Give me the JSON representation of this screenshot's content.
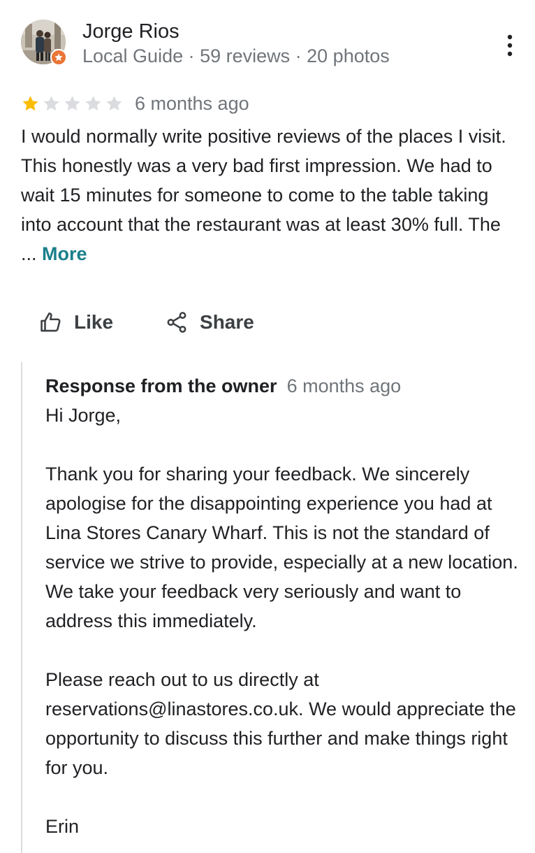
{
  "reviewer": {
    "name": "Jorge Rios",
    "meta": "Local Guide · 59 reviews · 20 photos"
  },
  "review": {
    "rating": 1,
    "max_rating": 5,
    "date": "6 months ago",
    "text": "I would normally write positive reviews of the places I visit. This honestly was a very bad first impression. We had to wait 15 minutes for someone to come to the table taking into account that the restaurant was at least 30% full. The ...",
    "more_label": "More"
  },
  "actions": {
    "like_label": "Like",
    "share_label": "Share"
  },
  "owner_response": {
    "title": "Response from the owner",
    "date": "6 months ago",
    "greeting": "Hi Jorge,",
    "paragraph1": "Thank you for sharing your feedback. We sincerely apologise for the disappointing experience you had at Lina Stores Canary Wharf. This is not the standard of service we strive to provide, especially at a new location. We take your feedback very seriously and want to address this immediately.",
    "paragraph2": "Please reach out to us directly at reservations@linastores.co.uk. We would appreciate the opportunity to discuss this further and make things right for you.",
    "signoff": "Erin"
  },
  "icons": {
    "avatar": "user-photo",
    "badge": "local-guide-star-icon",
    "menu": "more-vert-icon",
    "like": "thumb-up-icon",
    "share": "share-icon",
    "star": "star-icon"
  },
  "colors": {
    "star_filled": "#fbbc04",
    "star_empty": "#dadce0",
    "link": "#1a7f8a",
    "secondary_text": "#70757a",
    "badge": "#ea7536"
  }
}
